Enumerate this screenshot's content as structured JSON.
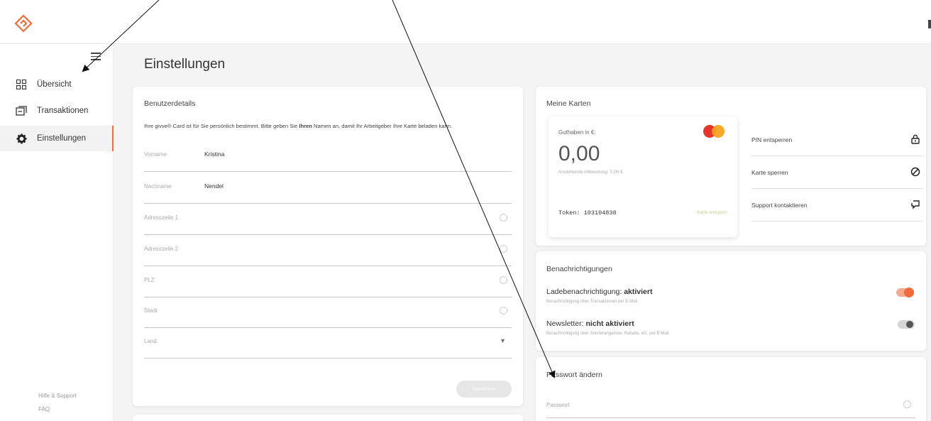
{
  "page": {
    "title": "Einstellungen"
  },
  "sidebar": {
    "items": [
      {
        "label": "Übersicht",
        "icon": "grid-icon"
      },
      {
        "label": "Transaktionen",
        "icon": "transactions-icon"
      },
      {
        "label": "Einstellungen",
        "icon": "gear-icon",
        "active": true
      }
    ],
    "footer_links": [
      "Hilfe & Support",
      "FAQ"
    ]
  },
  "user_details": {
    "title": "Benutzerdetails",
    "intro_before": "Ihre givve® Card ist für Sie persönlich bestimmt. Bitte geben Sie ",
    "intro_bold": "Ihren",
    "intro_after": " Namen an, damit Ihr Arbeitgeber Ihre Karte beladen kann.",
    "fields": [
      {
        "label": "Vorname",
        "value": "Kristina"
      },
      {
        "label": "Nachname",
        "value": "Nendel"
      },
      {
        "label": "Adresszeile 1",
        "value": ""
      },
      {
        "label": "Adresszeile 2",
        "value": ""
      },
      {
        "label": "PLZ",
        "value": ""
      },
      {
        "label": "Stadt",
        "value": ""
      },
      {
        "label": "Land",
        "value": ""
      }
    ],
    "save_label": "Speichern"
  },
  "my_cards": {
    "title": "Meine Karten",
    "balance_label": "Guthaben in €:",
    "balance": "0,00",
    "pending": "Anstehende Abbuchung: 0,00 €",
    "token": "Token: 103104838",
    "token_status": "Karte entsperrt",
    "actions": [
      {
        "label": "PIN entsperren",
        "icon": "lock-icon"
      },
      {
        "label": "Karte sperren",
        "icon": "block-icon"
      },
      {
        "label": "Support kontaktieren",
        "icon": "chat-icon"
      }
    ]
  },
  "notifications": {
    "title": "Benachrichtigungen",
    "items": [
      {
        "label": "Ladebenachrichtigung:",
        "status": "aktiviert",
        "sub": "Benachrichtigung über Transaktionen per E-Mail",
        "on": true
      },
      {
        "label": "Newsletter:",
        "status": "nicht aktiviert",
        "sub": "Benachrichtigung über Sonderangebote, Rabatte, etc. per E-Mail",
        "on": false
      }
    ]
  },
  "password": {
    "title": "Passwort ändern",
    "field_label": "Passwort"
  },
  "colors": {
    "accent": "#f26b3a",
    "background": "#f4f4f4"
  }
}
